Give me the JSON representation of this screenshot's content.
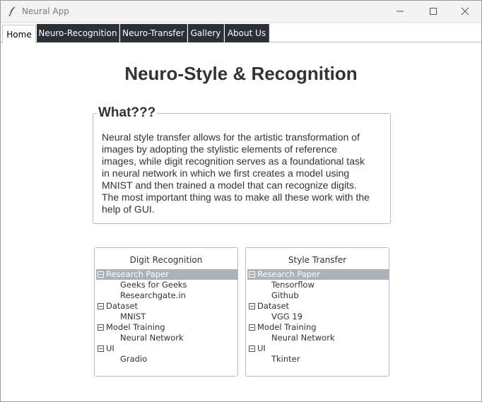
{
  "window": {
    "title": "Neural App"
  },
  "tabs": [
    {
      "label": "Home",
      "active": true
    },
    {
      "label": "Neuro-Recognition",
      "active": false
    },
    {
      "label": "Neuro-Transfer",
      "active": false
    },
    {
      "label": "Gallery",
      "active": false
    },
    {
      "label": "About Us",
      "active": false
    }
  ],
  "home": {
    "title": "Neuro-Style & Recognition",
    "what_heading": "What???",
    "description_lines": [
      "Neural style transfer allows for the artistic transformation of",
      "images by adopting the stylistic elements of reference",
      "images, while digit recognition serves as a foundational task",
      "in neural network in which we first creates a model using",
      "MNIST and then trained a model that can recognize digits.",
      "The most important thing was to make all these work with the",
      "help of GUI."
    ]
  },
  "digit_panel": {
    "title": "Digit Recognition",
    "tree": [
      {
        "label": "Research Paper",
        "children": [
          "Geeks for Geeks",
          "Researchgate.in"
        ],
        "selected": true
      },
      {
        "label": "Dataset",
        "children": [
          "MNIST"
        ]
      },
      {
        "label": "Model Training",
        "children": [
          "Neural Network"
        ]
      },
      {
        "label": "UI",
        "children": [
          "Gradio"
        ]
      }
    ]
  },
  "style_panel": {
    "title": "Style Transfer",
    "tree": [
      {
        "label": "Research Paper",
        "children": [
          "Tensorflow",
          "Github"
        ],
        "selected": true
      },
      {
        "label": "Dataset",
        "children": [
          "VGG 19"
        ]
      },
      {
        "label": "Model Training",
        "children": [
          "Neural Network"
        ]
      },
      {
        "label": "UI",
        "children": [
          "Tkinter"
        ]
      }
    ]
  },
  "colors": {
    "tab_dark": "#2b2f36",
    "selection": "#a9b1bb",
    "text": "#333333"
  },
  "icons": [
    "feather-icon",
    "minimize-icon",
    "maximize-icon",
    "close-icon",
    "collapse-icon"
  ]
}
